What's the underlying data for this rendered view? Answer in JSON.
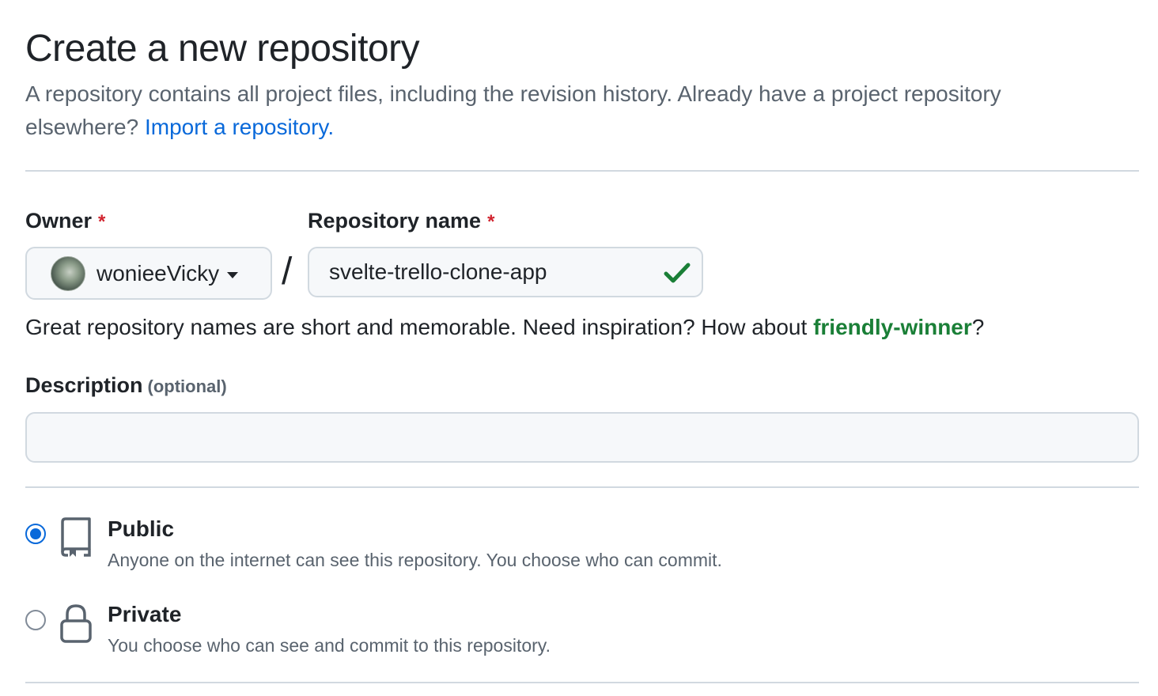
{
  "header": {
    "title": "Create a new repository",
    "subtitle": "A repository contains all project files, including the revision history. Already have a project repository elsewhere?",
    "import_link": "Import a repository."
  },
  "owner": {
    "label": "Owner",
    "required_mark": "*",
    "value": "wonieeVicky"
  },
  "separator": "/",
  "repo_name": {
    "label": "Repository name",
    "required_mark": "*",
    "value": "svelte-trello-clone-app"
  },
  "name_hint": {
    "text": "Great repository names are short and memorable. Need inspiration? How about",
    "suggestion": "friendly-winner",
    "suffix": "?"
  },
  "description": {
    "label": "Description",
    "optional": "(optional)",
    "value": ""
  },
  "visibility": {
    "selected": "public",
    "options": [
      {
        "title": "Public",
        "description": "Anyone on the internet can see this repository. You choose who can commit.",
        "icon": "repo-icon"
      },
      {
        "title": "Private",
        "description": "You choose who can see and commit to this repository.",
        "icon": "lock-icon"
      }
    ]
  },
  "colors": {
    "link": "#0969da",
    "success": "#1a7f37",
    "required": "#d1242f",
    "radio_selected": "#0969da"
  }
}
